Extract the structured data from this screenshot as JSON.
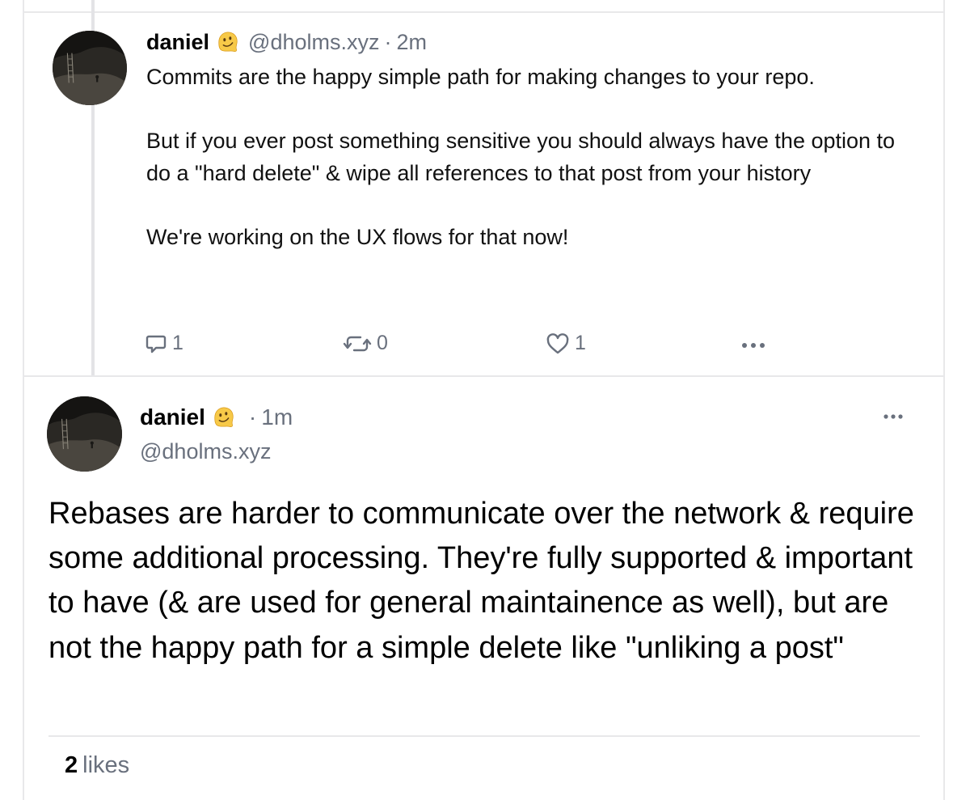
{
  "reply_post": {
    "author_name": "daniel",
    "author_emoji": "melting-face-emoji",
    "handle": "@dholms.xyz",
    "separator": "·",
    "time": "2m",
    "paragraphs": [
      "Commits are the happy simple path for making changes to your repo.",
      "But if you ever post something sensitive you should always have the option to do a \"hard delete\" & wipe all references to that post from your history",
      "We're working on the UX flows for that now!"
    ],
    "actions": {
      "reply_count": "1",
      "repost_count": "0",
      "like_count": "1"
    }
  },
  "main_post": {
    "author_name": "daniel",
    "author_emoji": "melting-face-emoji",
    "separator": "·",
    "time": "1m",
    "handle": "@dholms.xyz",
    "body": "Rebases are harder to communicate over the network & require some additional processing. They're fully supported & important to have (& are used for general maintainence as well), but are not the happy path for a simple delete like \"unliking a post\"",
    "likes_count": "2",
    "likes_label": "likes"
  },
  "colors": {
    "muted_text": "#69707d",
    "divider": "#e8e8ea",
    "thread_line": "#e3e3e6",
    "emoji_yellow": "#f7c948"
  },
  "icons": [
    "reply-icon",
    "repost-icon",
    "like-icon",
    "more-icon",
    "melting-face-emoji"
  ]
}
